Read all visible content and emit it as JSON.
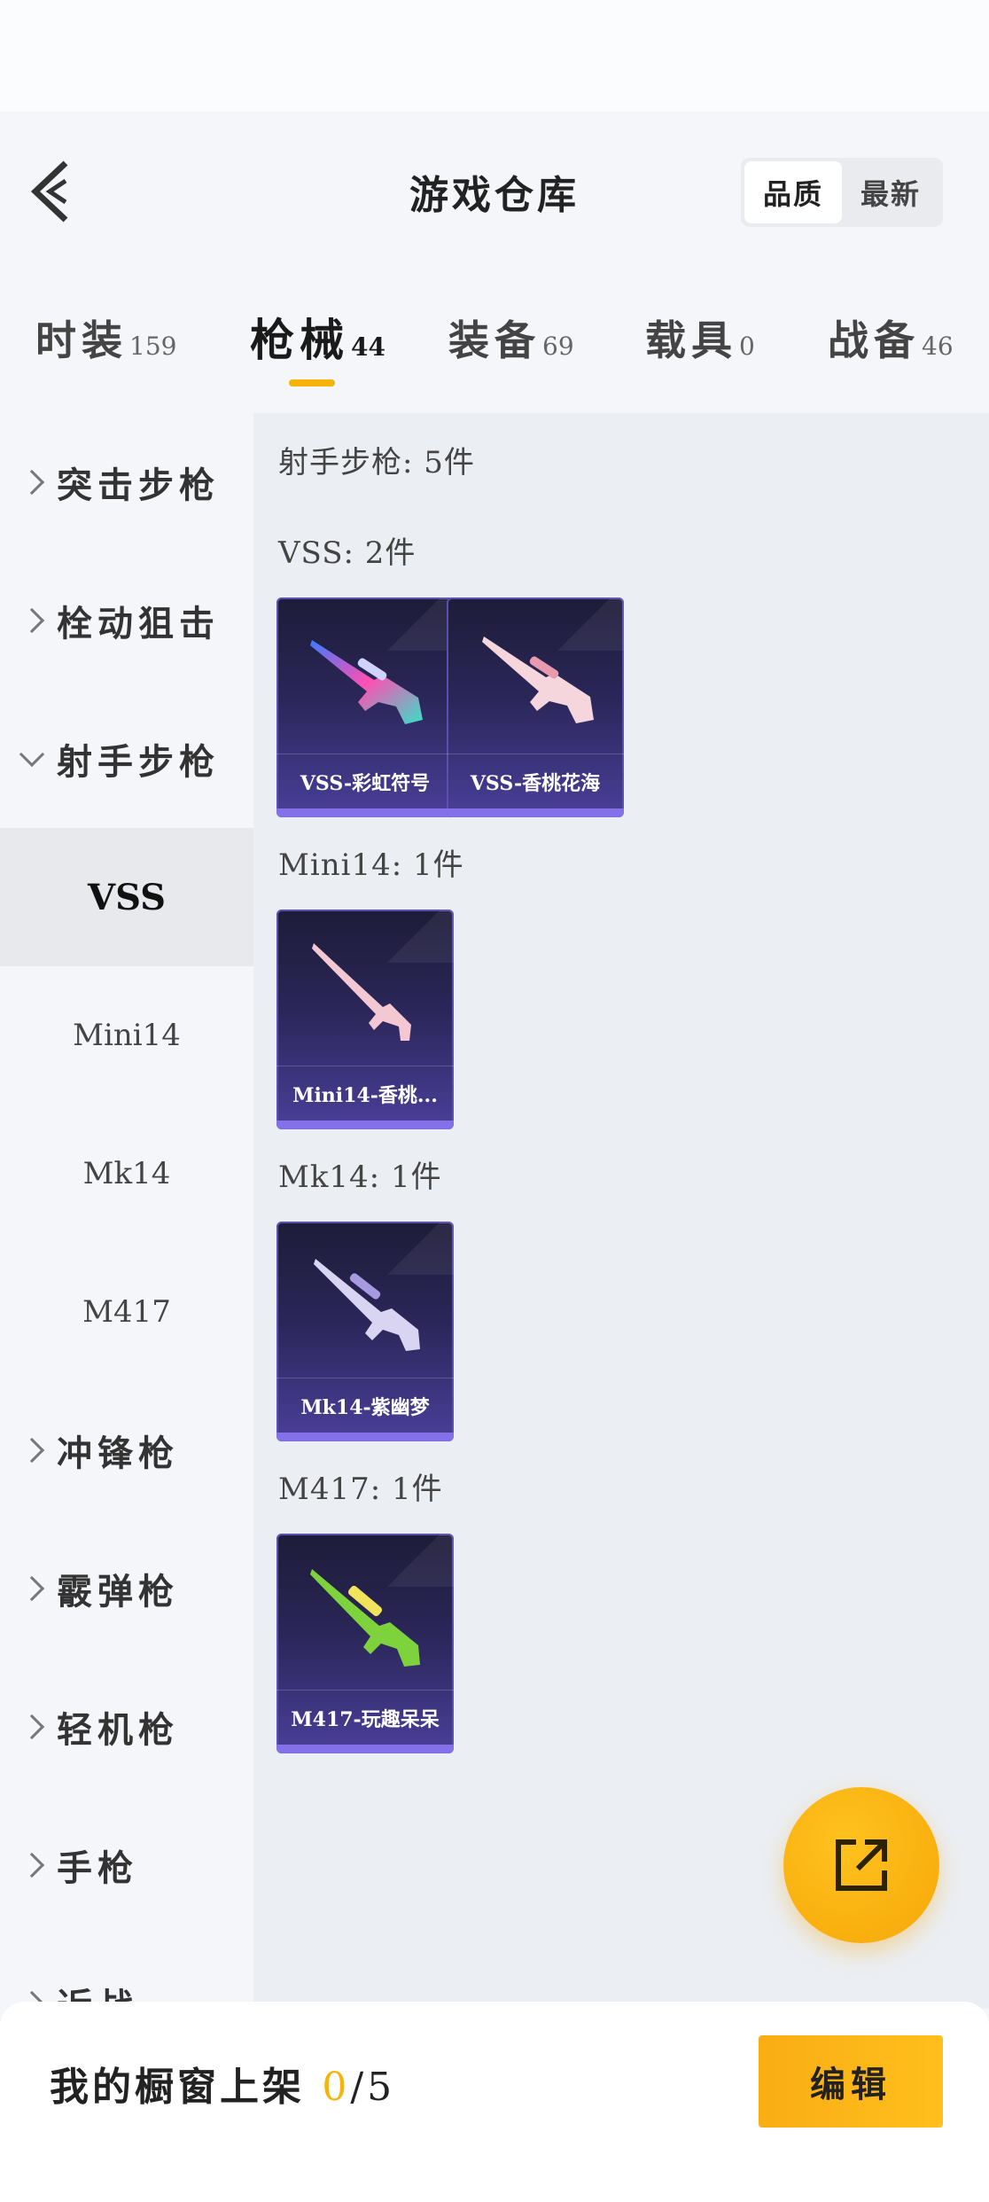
{
  "header": {
    "title": "游戏仓库",
    "sort_options": [
      "品质",
      "最新"
    ],
    "sort_selected": "品质"
  },
  "tabs": [
    {
      "label": "时装",
      "count": "159"
    },
    {
      "label": "枪械",
      "count": "44",
      "active": true
    },
    {
      "label": "装备",
      "count": "69"
    },
    {
      "label": "载具",
      "count": "0"
    },
    {
      "label": "战备",
      "count": "46"
    }
  ],
  "sidebar": {
    "categories": [
      {
        "label": "突击步枪",
        "expanded": false
      },
      {
        "label": "栓动狙击",
        "expanded": false
      },
      {
        "label": "射手步枪",
        "expanded": true
      },
      {
        "label": "冲锋枪",
        "expanded": false
      },
      {
        "label": "霰弹枪",
        "expanded": false
      },
      {
        "label": "轻机枪",
        "expanded": false
      },
      {
        "label": "手枪",
        "expanded": false
      },
      {
        "label": "近战",
        "expanded": false
      }
    ],
    "subitems": [
      "VSS",
      "Mini14",
      "Mk14",
      "M417"
    ],
    "active_subitem": "VSS"
  },
  "content": {
    "section_title": "射手步枪: 5件",
    "groups": [
      {
        "title": "VSS: 2件",
        "items": [
          {
            "name": "VSS-彩虹符号",
            "icon": "rainbow-sniper-rifle-icon"
          },
          {
            "name": "VSS-香桃花海",
            "icon": "pink-sniper-rifle-icon"
          }
        ]
      },
      {
        "title": "Mini14: 1件",
        "items": [
          {
            "name": "Mini14-香桃...",
            "icon": "pink-rifle-icon"
          }
        ]
      },
      {
        "title": "Mk14: 1件",
        "items": [
          {
            "name": "Mk14-紫幽梦",
            "icon": "purple-rifle-icon"
          }
        ]
      },
      {
        "title": "M417: 1件",
        "items": [
          {
            "name": "M417-玩趣呆呆",
            "icon": "green-rifle-icon"
          }
        ]
      }
    ]
  },
  "fab": {
    "icon": "share-external-icon"
  },
  "footer": {
    "showcase_label": "我的橱窗上架",
    "showcase_count": "0",
    "showcase_total": "/5",
    "edit_label": "编辑"
  },
  "colors": {
    "accent": "#f6b40a",
    "card_bg": "#2a2658",
    "card_base": "#8470e8"
  }
}
